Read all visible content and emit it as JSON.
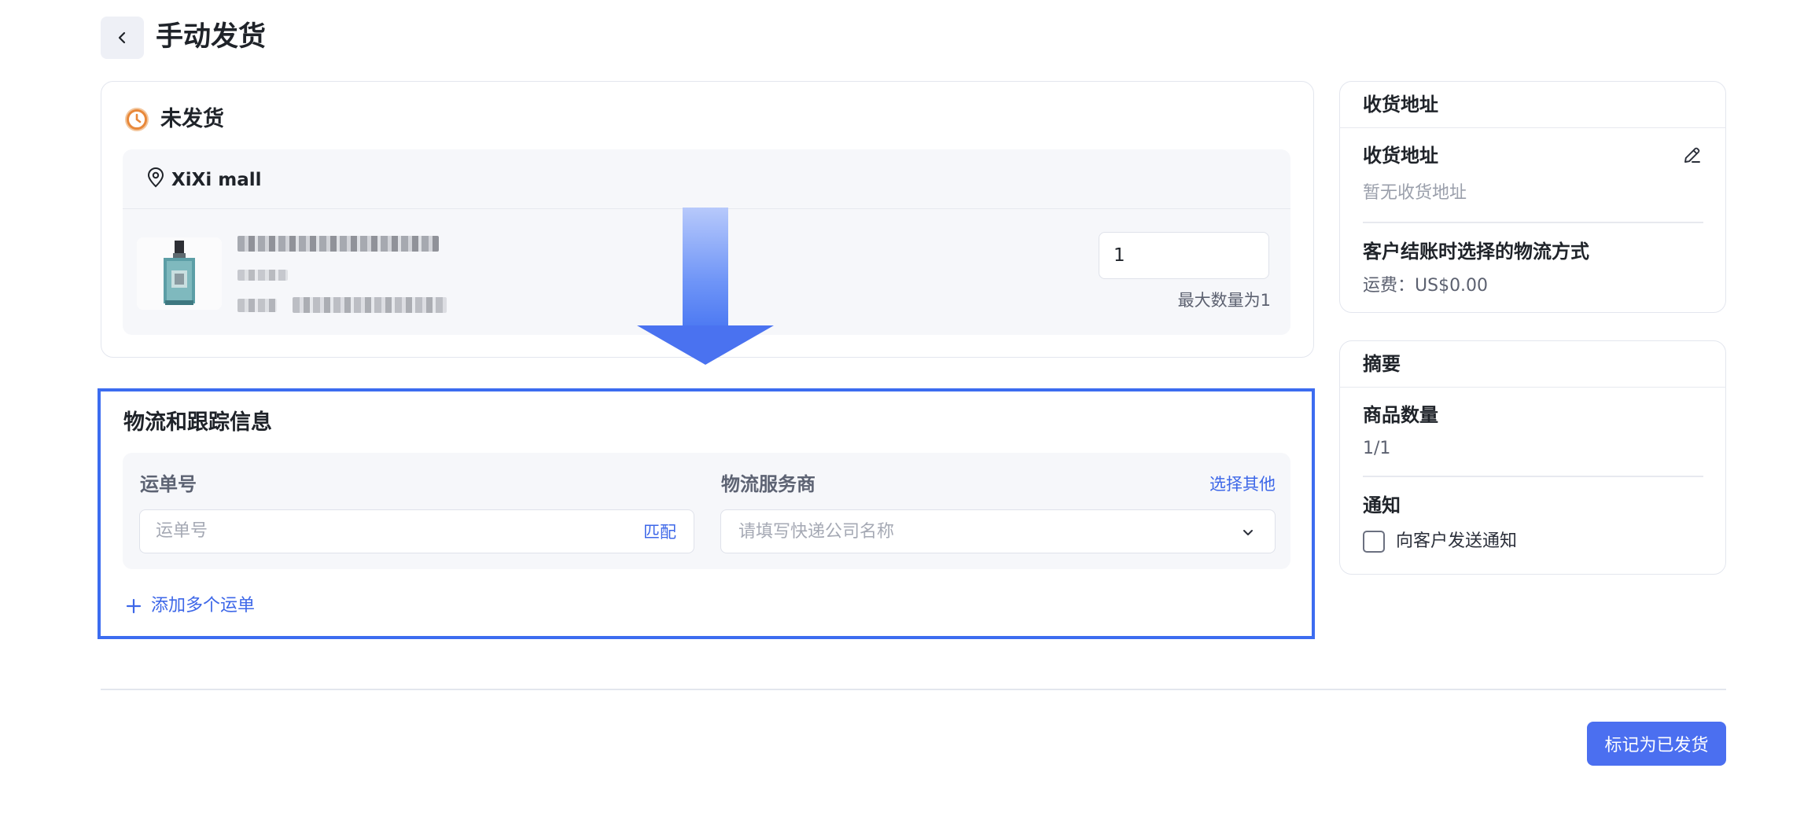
{
  "header": {
    "title": "手动发货",
    "back_icon": "chevron-left-icon"
  },
  "fulfillment": {
    "status_label": "未发货",
    "status_icon": "clock-icon",
    "status_color": "#e8883a",
    "store_icon": "location-pin-icon",
    "store_name": "XiXi mall",
    "product": {
      "quantity_value": "1",
      "max_quantity_hint": "最大数量为1"
    }
  },
  "logistics": {
    "title": "物流和跟踪信息",
    "tracking_label": "运单号",
    "tracking_placeholder": "运单号",
    "match_label": "匹配",
    "carrier_label": "物流服务商",
    "select_other_label": "选择其他",
    "carrier_placeholder": "请填写快递公司名称",
    "add_more_label": "添加多个运单",
    "highlight_color": "#3c6cf0"
  },
  "address_card": {
    "header_title": "收货地址",
    "section_title": "收货地址",
    "empty_text": "暂无收货地址",
    "shipping_method_title": "客户结账时选择的物流方式",
    "shipping_fee": "运费：US$0.00"
  },
  "summary_card": {
    "title": "摘要",
    "item_count_label": "商品数量",
    "item_count_value": "1/1",
    "notify_label": "通知",
    "notify_checkbox_label": "向客户发送通知",
    "notify_checked": false
  },
  "footer": {
    "mark_shipped_label": "标记为已发货",
    "button_color": "#4b6ff0"
  }
}
